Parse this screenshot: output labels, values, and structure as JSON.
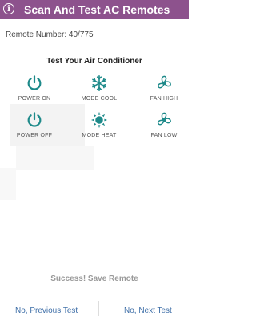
{
  "app_bar": {
    "title": "Scan And Test AC Remotes",
    "info_icon_glyph": "i",
    "color": "#8d528d"
  },
  "remote_number": "Remote Number: 40/775",
  "section_title": "Test Your Air Conditioner",
  "icon_color": "#1e8a8a",
  "buttons": [
    {
      "label": "POWER ON",
      "icon": "power-icon"
    },
    {
      "label": "MODE COOL",
      "icon": "snowflake-icon"
    },
    {
      "label": "FAN HIGH",
      "icon": "fan-icon"
    },
    {
      "label": "POWER OFF",
      "icon": "power-icon"
    },
    {
      "label": "MODE HEAT",
      "icon": "sun-icon"
    },
    {
      "label": "FAN LOW",
      "icon": "fan-icon"
    }
  ],
  "save_label": "Success! Save Remote",
  "nav": {
    "previous_label": "No, Previous Test",
    "next_label": "No, Next Test",
    "link_color": "#3f6fa8"
  }
}
